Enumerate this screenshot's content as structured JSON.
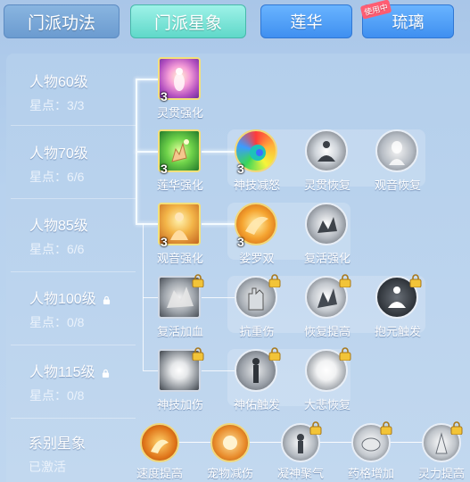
{
  "tabs": {
    "main1": "门派功法",
    "main2": "门派星象",
    "sub1": "莲华",
    "sub2": "琉璃",
    "in_use_badge": "使用中"
  },
  "rows": [
    {
      "level": "人物60级",
      "points": "星点：3/3",
      "locked": false
    },
    {
      "level": "人物70级",
      "points": "星点：6/6",
      "locked": false
    },
    {
      "level": "人物85级",
      "points": "星点：6/6",
      "locked": false
    },
    {
      "level": "人物100级",
      "points": "星点：0/8",
      "locked": true
    },
    {
      "level": "人物115级",
      "points": "星点：0/8",
      "locked": true
    }
  ],
  "skills": {
    "lingguan_qianghua": {
      "label": "灵贯强化",
      "level": "3"
    },
    "lianhua_qianghua": {
      "label": "莲华强化",
      "level": "3"
    },
    "shenji_jiannu": {
      "label": "神技减怒",
      "level": "3"
    },
    "lingguan_huifu": {
      "label": "灵贯恢复"
    },
    "guanyin_huifu": {
      "label": "观音恢复"
    },
    "guanyin_qianghua": {
      "label": "观音强化",
      "level": "3"
    },
    "suoluoshuang": {
      "label": "娑罗双",
      "level": "3"
    },
    "fuhuo_qianghua": {
      "label": "复活强化"
    },
    "fuhuo_jiaxue": {
      "label": "复活加血"
    },
    "kangzhongshang": {
      "label": "抗重伤"
    },
    "huifu_tigao": {
      "label": "恢复提高"
    },
    "baoyuan_chufa": {
      "label": "抱元触发"
    },
    "shenji_jiashang": {
      "label": "神技加伤"
    },
    "shenyou_chufa": {
      "label": "神佑触发"
    },
    "dabei_huifu": {
      "label": "大悲恢复"
    }
  },
  "faction": {
    "title": "系别星象",
    "status": "已激活",
    "items": [
      {
        "label": "速度提高"
      },
      {
        "label": "宠物减伤"
      },
      {
        "label": "凝神聚气"
      },
      {
        "label": "药格增加"
      },
      {
        "label": "灵力提高"
      }
    ]
  },
  "colors": {
    "active_tab": "#5fd8c9",
    "sub_tab": "#3f8ff0",
    "badge": "#ff5d72",
    "gold_border": "#f4e07a"
  }
}
